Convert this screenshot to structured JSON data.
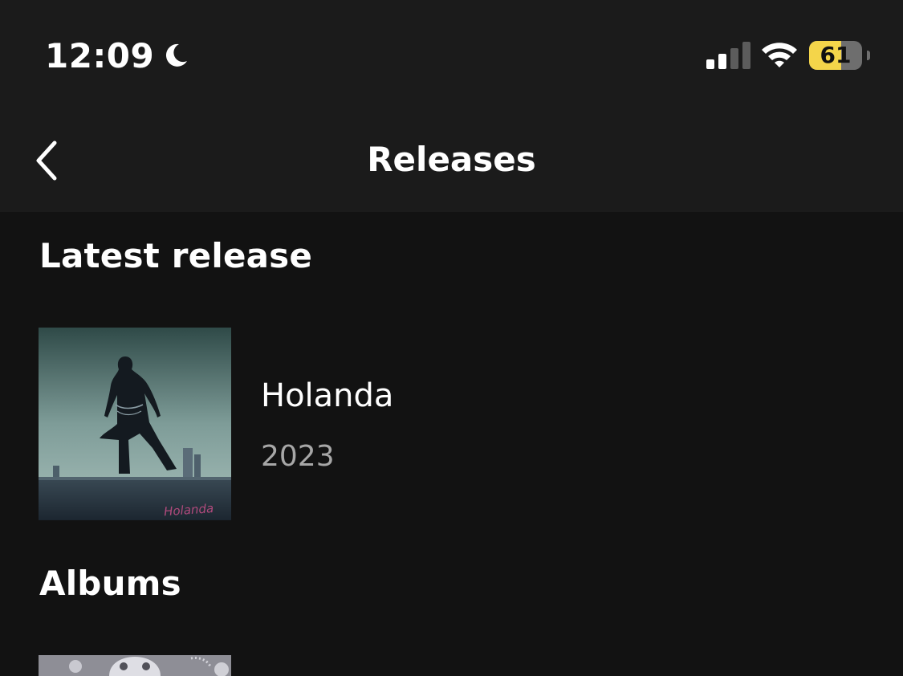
{
  "status_bar": {
    "time": "12:09",
    "battery_percent": "61",
    "battery_level": 0.61,
    "signal_bars_active": 2,
    "signal_bars_total": 4,
    "icons": [
      "moon-icon",
      "cellular-signal-icon",
      "wifi-icon",
      "battery-icon"
    ]
  },
  "nav": {
    "title": "Releases",
    "back_icon": "chevron-left-icon"
  },
  "latest_release": {
    "heading": "Latest release",
    "title": "Holanda",
    "year": "2023",
    "cover_text": "Holanda"
  },
  "albums": {
    "heading": "Albums"
  },
  "colors": {
    "background": "#121212",
    "bar_background": "#1b1b1b",
    "text_primary": "#ffffff",
    "text_secondary": "#a7a7a7",
    "battery_fill": "#f4d54a"
  }
}
